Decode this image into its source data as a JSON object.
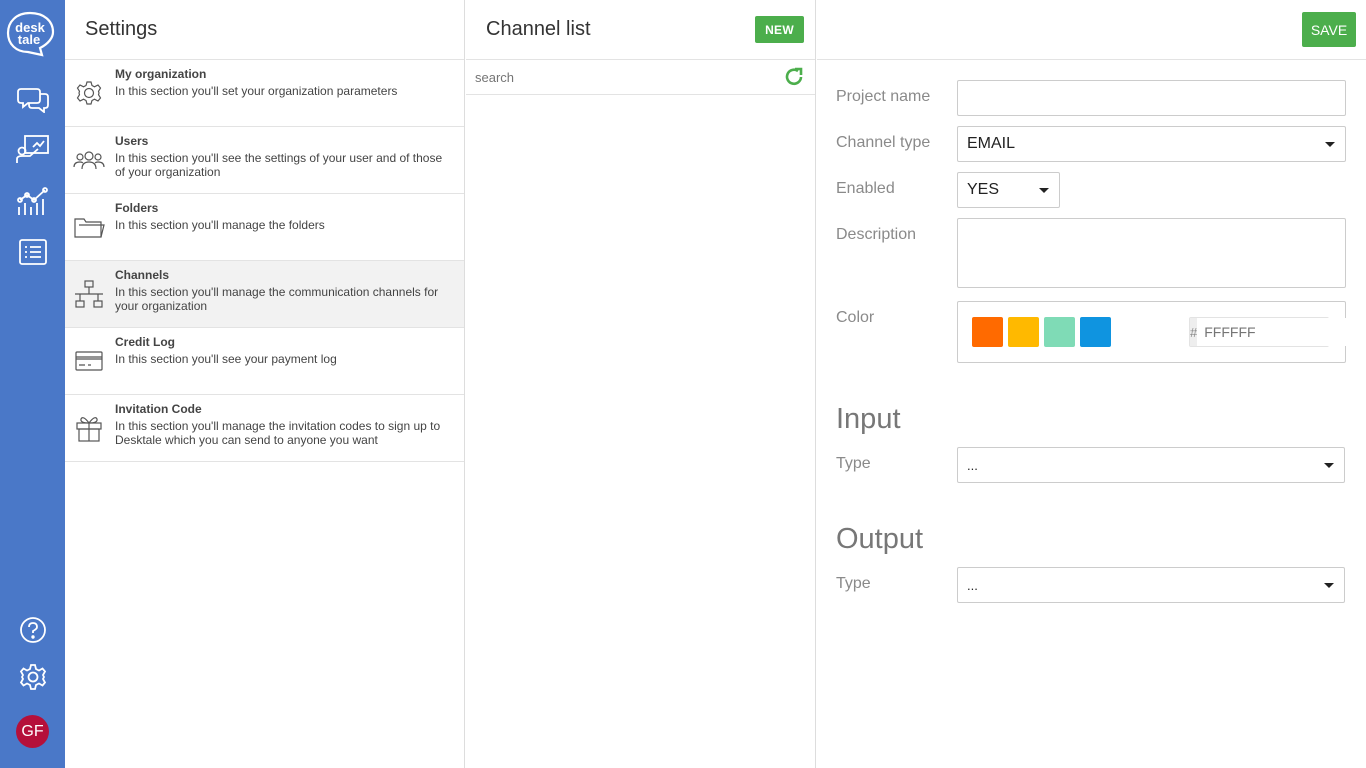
{
  "rail": {
    "logo_line1": "desk",
    "logo_line2": "tale",
    "avatar_initials": "GF",
    "icons": [
      "chat-icon",
      "presentation-icon",
      "analytics-icon",
      "list-icon",
      "help-icon",
      "gear-icon"
    ]
  },
  "settings": {
    "title": "Settings",
    "items": [
      {
        "title": "My organization",
        "desc": "In this section you'll set your organization parameters",
        "icon": "gear-icon"
      },
      {
        "title": "Users",
        "desc": "In this section you'll see the settings of your user and of those of your organization",
        "icon": "users-icon"
      },
      {
        "title": "Folders",
        "desc": "In this section you'll manage the folders",
        "icon": "folder-icon"
      },
      {
        "title": "Channels",
        "desc": "In this section you'll manage the communication channels for your organization",
        "icon": "network-icon"
      },
      {
        "title": "Credit Log",
        "desc": "In this section you'll see your payment log",
        "icon": "credit-card-icon"
      },
      {
        "title": "Invitation Code",
        "desc": "In this section you'll manage the invitation codes to sign up to Desktale which you can send to anyone you want",
        "icon": "gift-icon"
      }
    ],
    "active_index": 3
  },
  "channel_list": {
    "title": "Channel list",
    "new_label": "NEW",
    "search_placeholder": "search"
  },
  "form": {
    "save_label": "SAVE",
    "project_name_label": "Project name",
    "project_name_value": "",
    "channel_type_label": "Channel type",
    "channel_type_value": "EMAIL",
    "enabled_label": "Enabled",
    "enabled_value": "YES",
    "description_label": "Description",
    "description_value": "",
    "color_label": "Color",
    "color_swatches": [
      "#ff6a00",
      "#ffb900",
      "#7fdbb6",
      "#0f94e0"
    ],
    "hex_prefix": "#",
    "hex_placeholder": "FFFFFF",
    "input_section_title": "Input",
    "input_type_label": "Type",
    "input_type_value": "...",
    "output_section_title": "Output",
    "output_type_label": "Type",
    "output_type_value": "..."
  },
  "colors": {
    "rail_bg": "#4a78c8",
    "accent_green": "#4cae4c",
    "avatar_bg": "#b5103a"
  }
}
